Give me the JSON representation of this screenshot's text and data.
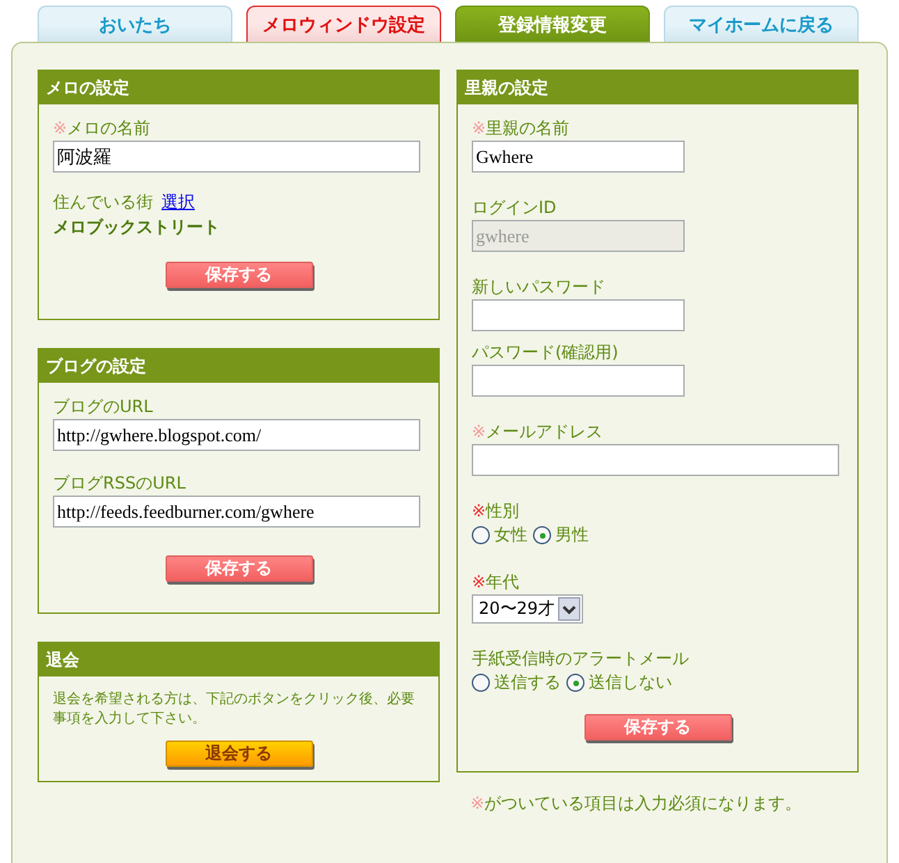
{
  "tabs": [
    {
      "label": "おいたち",
      "kind": "blue",
      "selected": false
    },
    {
      "label": "メロウィンドウ設定",
      "kind": "red",
      "selected": false
    },
    {
      "label": "登録情報変更",
      "kind": "blue",
      "selected": true
    },
    {
      "label": "マイホームに戻る",
      "kind": "blue",
      "selected": false
    }
  ],
  "mero_settings": {
    "title": "メロの設定",
    "name_field": {
      "mark": "※",
      "label": "メロの名前",
      "value": "阿波羅"
    },
    "town": {
      "label": "住んでいる街",
      "link": "選択",
      "value": "メロブックストリート"
    },
    "save_button": "保存する"
  },
  "blog_settings": {
    "title": "ブログの設定",
    "fields": [
      {
        "label": "ブログのURL",
        "value": "http://gwhere.blogspot.com/"
      },
      {
        "label": "ブログRSSのURL",
        "value": "http://feeds.feedburner.com/gwhere"
      }
    ],
    "save_button": "保存する"
  },
  "withdraw": {
    "title": "退会",
    "text": "退会を希望される方は、下記のボタンをクリック後、必要事項を入力して下さい。",
    "button": "退会する"
  },
  "parent_settings": {
    "title": "里親の設定",
    "fields": [
      {
        "kind": "input",
        "mark": "※",
        "label": "里親の名前",
        "value": "Gwhere",
        "disabled": false,
        "wide": false
      },
      {
        "kind": "input",
        "label": "ログインID",
        "value": "gwhere",
        "disabled": true,
        "wide": false
      },
      {
        "kind": "input",
        "label": "新しいパスワード",
        "disabled": false,
        "wide": false
      },
      {
        "kind": "input",
        "label": "パスワード(確認用)",
        "disabled": false,
        "wide": false
      },
      {
        "kind": "input",
        "mark": "※",
        "label": "メールアドレス",
        "disabled": false,
        "wide": true
      },
      {
        "kind": "radio",
        "mark": "※",
        "label": "性別",
        "options": [
          {
            "label": "女性",
            "selected": false
          },
          {
            "label": "男性",
            "selected": true
          }
        ]
      },
      {
        "kind": "select",
        "mark": "※",
        "label": "年代",
        "value": "20〜29才"
      },
      {
        "kind": "radio",
        "label": "手紙受信時のアラートメール",
        "options": [
          {
            "label": "送信する",
            "selected": false
          },
          {
            "label": "送信しない",
            "selected": true
          }
        ]
      }
    ],
    "save_button": "保存する"
  },
  "note": {
    "mark": "※",
    "text": "がついている項目は入力必須になります。"
  }
}
